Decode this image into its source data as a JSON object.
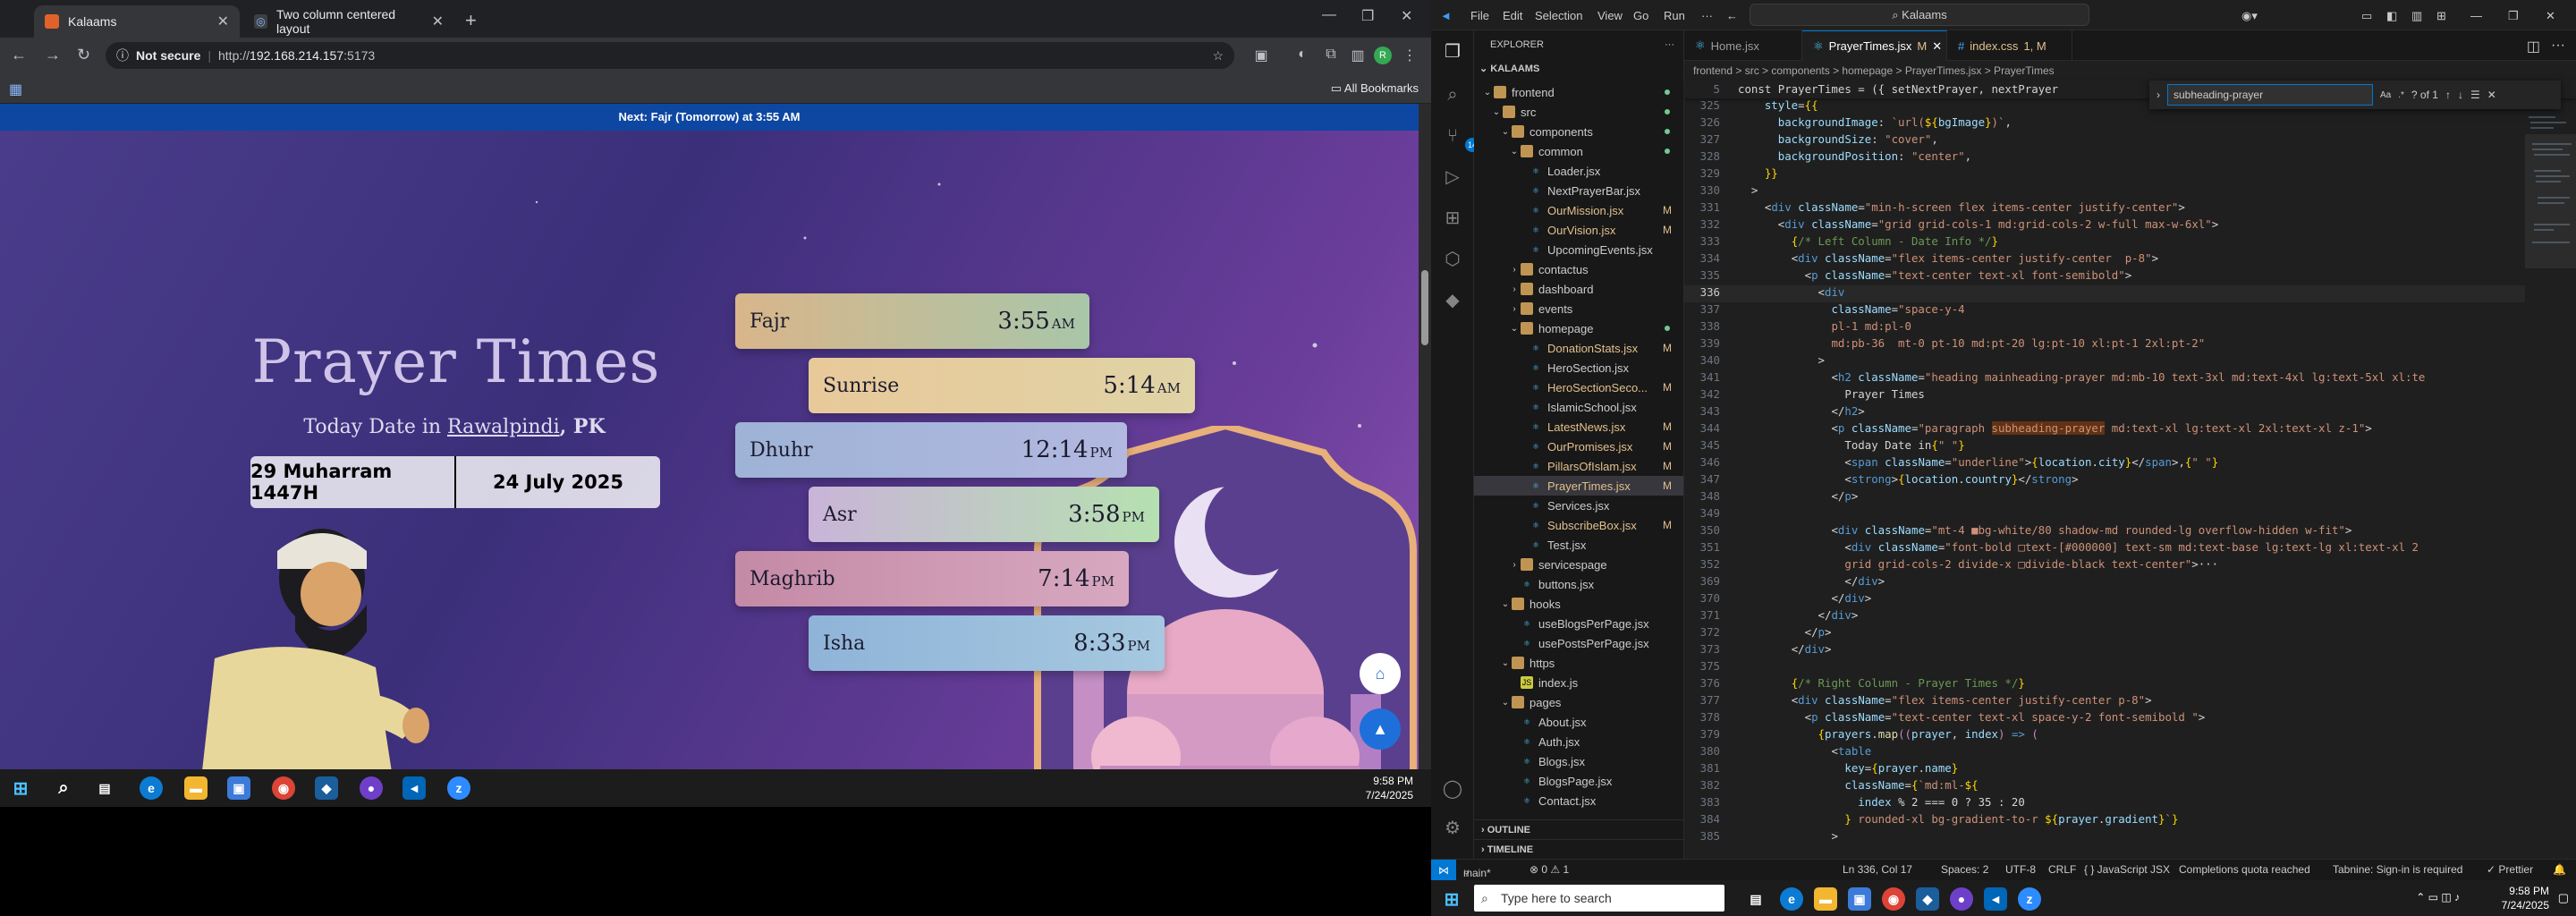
{
  "browser": {
    "tabs": [
      {
        "title": "Kalaams",
        "active": true
      },
      {
        "title": "Two column centered layout",
        "active": false
      }
    ],
    "not_secure": "Not secure",
    "url_prefix": "http://",
    "url_host": "192.168.214.157",
    "url_suffix": ":5173",
    "all_bookmarks": "All Bookmarks",
    "profile_initial": "R"
  },
  "page": {
    "next_prayer_prefix": "Next: ",
    "next_prayer_name": "Fajr (Tomorrow)",
    "next_prayer_suffix": " at 3:55 AM",
    "title": "Prayer Times",
    "date_prefix": "Today Date in ",
    "city": "Rawalpindi",
    "country": ", PK",
    "hijri_date": "29 Muharram 1447H",
    "gregorian_date": "24 July 2025",
    "prayers": [
      {
        "name": "Fajr",
        "time": "3:55",
        "ampm": "AM",
        "gradient": [
          "#d9b58a",
          "#a8c6a8"
        ]
      },
      {
        "name": "Sunrise",
        "time": "5:14",
        "ampm": "AM",
        "gradient": [
          "#e8c99a",
          "#e0d3a6"
        ]
      },
      {
        "name": "Dhuhr",
        "time": "12:14",
        "ampm": "PM",
        "gradient": [
          "#9eb3d6",
          "#b2b8e0"
        ]
      },
      {
        "name": "Asr",
        "time": "3:58",
        "ampm": "PM",
        "gradient": [
          "#c9b4d8",
          "#b6e0b0"
        ]
      },
      {
        "name": "Maghrib",
        "time": "7:14",
        "ampm": "PM",
        "gradient": [
          "#c48aa6",
          "#d7a8c0"
        ]
      },
      {
        "name": "Isha",
        "time": "8:33",
        "ampm": "PM",
        "gradient": [
          "#8fb4d8",
          "#a6c8e0"
        ]
      }
    ]
  },
  "taskbar_left": {
    "time": "9:58 PM",
    "date": "7/24/2025"
  },
  "vscode": {
    "menu": [
      "File",
      "Edit",
      "Selection",
      "View",
      "Go",
      "Run",
      "···"
    ],
    "command_center": "Kalaams",
    "explorer_title": "EXPLORER",
    "workspace": "KALAAMS",
    "tree": [
      {
        "label": "frontend",
        "type": "folder",
        "depth": 0,
        "open": true,
        "dot": true
      },
      {
        "label": "src",
        "type": "folder",
        "depth": 1,
        "open": true,
        "dot": true
      },
      {
        "label": "components",
        "type": "folder",
        "depth": 2,
        "open": true,
        "dot": true
      },
      {
        "label": "common",
        "type": "folder",
        "depth": 3,
        "open": true,
        "dot": true
      },
      {
        "label": "Loader.jsx",
        "type": "jsx",
        "depth": 4
      },
      {
        "label": "NextPrayerBar.jsx",
        "type": "jsx",
        "depth": 4
      },
      {
        "label": "OurMission.jsx",
        "type": "jsx",
        "depth": 4,
        "badge": "M"
      },
      {
        "label": "OurVision.jsx",
        "type": "jsx",
        "depth": 4,
        "badge": "M"
      },
      {
        "label": "UpcomingEvents.jsx",
        "type": "jsx",
        "depth": 4
      },
      {
        "label": "contactus",
        "type": "folder",
        "depth": 3
      },
      {
        "label": "dashboard",
        "type": "folder",
        "depth": 3
      },
      {
        "label": "events",
        "type": "folder",
        "depth": 3
      },
      {
        "label": "homepage",
        "type": "folder",
        "depth": 3,
        "open": true,
        "dot": true
      },
      {
        "label": "DonationStats.jsx",
        "type": "jsx",
        "depth": 4,
        "badge": "M"
      },
      {
        "label": "HeroSection.jsx",
        "type": "jsx",
        "depth": 4
      },
      {
        "label": "HeroSectionSeco...",
        "type": "jsx",
        "depth": 4,
        "badge": "M"
      },
      {
        "label": "IslamicSchool.jsx",
        "type": "jsx",
        "depth": 4
      },
      {
        "label": "LatestNews.jsx",
        "type": "jsx",
        "depth": 4,
        "badge": "M"
      },
      {
        "label": "OurPromises.jsx",
        "type": "jsx",
        "depth": 4,
        "badge": "M"
      },
      {
        "label": "PillarsOfIslam.jsx",
        "type": "jsx",
        "depth": 4,
        "badge": "M"
      },
      {
        "label": "PrayerTimes.jsx",
        "type": "jsx",
        "depth": 4,
        "badge": "M",
        "selected": true
      },
      {
        "label": "Services.jsx",
        "type": "jsx",
        "depth": 4
      },
      {
        "label": "SubscribeBox.jsx",
        "type": "jsx",
        "depth": 4,
        "badge": "M"
      },
      {
        "label": "Test.jsx",
        "type": "jsx",
        "depth": 4
      },
      {
        "label": "servicespage",
        "type": "folder",
        "depth": 3
      },
      {
        "label": "buttons.jsx",
        "type": "jsx",
        "depth": 3
      },
      {
        "label": "hooks",
        "type": "folder",
        "depth": 2,
        "open": true
      },
      {
        "label": "useBlogsPerPage.jsx",
        "type": "jsx",
        "depth": 3
      },
      {
        "label": "usePostsPerPage.jsx",
        "type": "jsx",
        "depth": 3
      },
      {
        "label": "https",
        "type": "folder",
        "depth": 2,
        "open": true
      },
      {
        "label": "index.js",
        "type": "js",
        "depth": 3
      },
      {
        "label": "pages",
        "type": "folder",
        "depth": 2,
        "open": true
      },
      {
        "label": "About.jsx",
        "type": "jsx",
        "depth": 3
      },
      {
        "label": "Auth.jsx",
        "type": "jsx",
        "depth": 3
      },
      {
        "label": "Blogs.jsx",
        "type": "jsx",
        "depth": 3
      },
      {
        "label": "BlogsPage.jsx",
        "type": "jsx",
        "depth": 3
      },
      {
        "label": "Contact.jsx",
        "type": "jsx",
        "depth": 3
      }
    ],
    "outline": "OUTLINE",
    "timeline": "TIMELINE",
    "tabs": [
      {
        "title": "Home.jsx",
        "mod": "",
        "active": false
      },
      {
        "title": "PrayerTimes.jsx",
        "mod": "M",
        "active": true
      },
      {
        "title": "index.css",
        "mod": "1, M",
        "active": false
      }
    ],
    "breadcrumbs": "frontend > src > components > homepage > PrayerTimes.jsx > PrayerTimes",
    "sticky_line": {
      "num": "5",
      "text": "const PrayerTimes = ({ setNextPrayer, nextPrayer"
    },
    "find": {
      "query": "subheading-prayer",
      "result": "? of 1"
    },
    "status": {
      "branch": "main*",
      "problems": "⊗ 0 ⚠ 1",
      "position": "Ln 336, Col 17",
      "spaces": "Spaces: 2",
      "encoding": "UTF-8",
      "eol": "CRLF",
      "language": "{ } JavaScript JSX",
      "quota": "Completions quota reached",
      "tabnine": "Tabnine: Sign-in is required",
      "prettier": "✓ Prettier"
    },
    "code_lines": [
      {
        "n": "325",
        "h": "    <span class='a'>style</span><span class='o'>=</span><span class='p'>{{</span>"
      },
      {
        "n": "326",
        "h": "      <span class='a'>backgroundImage</span><span class='o'>: </span><span class='s'>`url(</span><span class='p'>${</span><span class='a'>bgImage</span><span class='p'>}</span><span class='s'>)`</span><span class='o'>,</span>"
      },
      {
        "n": "327",
        "h": "      <span class='a'>backgroundSize</span><span class='o'>: </span><span class='s'>\"cover\"</span><span class='o'>,</span>"
      },
      {
        "n": "328",
        "h": "      <span class='a'>backgroundPosition</span><span class='o'>: </span><span class='s'>\"center\"</span><span class='o'>,</span>"
      },
      {
        "n": "329",
        "h": "    <span class='p'>}}</span>"
      },
      {
        "n": "330",
        "h": "  <span class='o'>&gt;</span>"
      },
      {
        "n": "331",
        "h": "    <span class='o'>&lt;</span><span class='k'>div</span> <span class='a'>className</span><span class='o'>=</span><span class='s'>\"min-h-screen flex items-center justify-center\"</span><span class='o'>&gt;</span>"
      },
      {
        "n": "332",
        "h": "      <span class='o'>&lt;</span><span class='k'>div</span> <span class='a'>className</span><span class='o'>=</span><span class='s'>\"grid grid-cols-1 md:grid-cols-2 w-full max-w-6xl\"</span><span class='o'>&gt;</span>"
      },
      {
        "n": "333",
        "h": "        <span class='p'>{</span><span class='c'>/* Left Column - Date Info */</span><span class='p'>}</span>"
      },
      {
        "n": "334",
        "h": "        <span class='o'>&lt;</span><span class='k'>div</span> <span class='a'>className</span><span class='o'>=</span><span class='s'>\"flex items-center justify-center  p-8\"</span><span class='o'>&gt;</span>"
      },
      {
        "n": "335",
        "h": "          <span class='o'>&lt;</span><span class='k'>p</span> <span class='a'>className</span><span class='o'>=</span><span class='s'>\"text-center text-xl font-semibold\"</span><span class='o'>&gt;</span>"
      },
      {
        "n": "336",
        "h": "            <span class='o'>&lt;</span><span class='k'>div</span>",
        "cur": true
      },
      {
        "n": "337",
        "h": "              <span class='a'>className</span><span class='o'>=</span><span class='s'>\"space-y-4</span>"
      },
      {
        "n": "338",
        "h": "              <span class='s'>pl-1 md:pl-0</span>"
      },
      {
        "n": "339",
        "h": "              <span class='s'>md:pb-36  mt-0 pt-10 md:pt-20 lg:pt-10 xl:pt-1 2xl:pt-2\"</span>"
      },
      {
        "n": "340",
        "h": "            <span class='o'>&gt;</span>"
      },
      {
        "n": "341",
        "h": "              <span class='o'>&lt;</span><span class='k'>h2</span> <span class='a'>className</span><span class='o'>=</span><span class='s'>\"heading mainheading-prayer md:mb-10 text-3xl md:text-4xl lg:text-5xl xl:te</span>"
      },
      {
        "n": "342",
        "h": "                <span class='o'>Prayer Times</span>"
      },
      {
        "n": "343",
        "h": "              <span class='o'>&lt;/</span><span class='k'>h2</span><span class='o'>&gt;</span>"
      },
      {
        "n": "344",
        "h": "              <span class='o'>&lt;</span><span class='k'>p</span> <span class='a'>className</span><span class='o'>=</span><span class='s'>\"paragraph <span class='hl'>subheading-prayer</span> md:text-xl lg:text-xl 2xl:text-xl z-1\"</span><span class='o'>&gt;</span>"
      },
      {
        "n": "345",
        "h": "                <span class='o'>Today Date in</span><span class='p'>{</span><span class='s'>\" \"</span><span class='p'>}</span>"
      },
      {
        "n": "346",
        "h": "                <span class='o'>&lt;</span><span class='k'>span</span> <span class='a'>className</span><span class='o'>=</span><span class='s'>\"underline\"</span><span class='o'>&gt;</span><span class='p'>{</span><span class='a'>location</span><span class='o'>.</span><span class='a'>city</span><span class='p'>}</span><span class='o'>&lt;/</span><span class='k'>span</span><span class='o'>&gt;,</span><span class='p'>{</span><span class='s'>\" \"</span><span class='p'>}</span>"
      },
      {
        "n": "347",
        "h": "                <span class='o'>&lt;</span><span class='k'>strong</span><span class='o'>&gt;</span><span class='p'>{</span><span class='a'>location</span><span class='o'>.</span><span class='a'>country</span><span class='p'>}</span><span class='o'>&lt;/</span><span class='k'>strong</span><span class='o'>&gt;</span>"
      },
      {
        "n": "348",
        "h": "              <span class='o'>&lt;/</span><span class='k'>p</span><span class='o'>&gt;</span>"
      },
      {
        "n": "349",
        "h": ""
      },
      {
        "n": "350",
        "h": "              <span class='o'>&lt;</span><span class='k'>div</span> <span class='a'>className</span><span class='o'>=</span><span class='s'>\"mt-4 ■bg-white/80 shadow-md rounded-lg overflow-hidden w-fit\"</span><span class='o'>&gt;</span>"
      },
      {
        "n": "351",
        "h": "                <span class='o'>&lt;</span><span class='k'>div</span> <span class='a'>className</span><span class='o'>=</span><span class='s'>\"font-bold □text-[#000000] text-sm md:text-base lg:text-lg xl:text-xl 2</span>"
      },
      {
        "n": "352",
        "h": "                <span class='s'>grid grid-cols-2 divide-x □divide-black text-center\"</span><span class='o'>&gt;···</span>"
      },
      {
        "n": "369",
        "h": "                <span class='o'>&lt;/</span><span class='k'>div</span><span class='o'>&gt;</span>"
      },
      {
        "n": "370",
        "h": "              <span class='o'>&lt;/</span><span class='k'>div</span><span class='o'>&gt;</span>"
      },
      {
        "n": "371",
        "h": "            <span class='o'>&lt;/</span><span class='k'>div</span><span class='o'>&gt;</span>"
      },
      {
        "n": "372",
        "h": "          <span class='o'>&lt;/</span><span class='k'>p</span><span class='o'>&gt;</span>"
      },
      {
        "n": "373",
        "h": "        <span class='o'>&lt;/</span><span class='k'>div</span><span class='o'>&gt;</span>"
      },
      {
        "n": "375",
        "h": ""
      },
      {
        "n": "376",
        "h": "        <span class='p'>{</span><span class='c'>/* Right Column - Prayer Times */</span><span class='p'>}</span>"
      },
      {
        "n": "377",
        "h": "        <span class='o'>&lt;</span><span class='k'>div</span> <span class='a'>className</span><span class='o'>=</span><span class='s'>\"flex items-center justify-center p-8\"</span><span class='o'>&gt;</span>"
      },
      {
        "n": "378",
        "h": "          <span class='o'>&lt;</span><span class='k'>p</span> <span class='a'>className</span><span class='o'>=</span><span class='s'>\"text-center text-xl space-y-2 font-semibold \"</span><span class='o'>&gt;</span>"
      },
      {
        "n": "379",
        "h": "            <span class='p'>{</span><span class='a'>prayers</span><span class='o'>.</span><span class='f'>map</span><span class='v'>((</span><span class='a'>prayer</span><span class='o'>, </span><span class='a'>index</span><span class='v'>)</span> <span class='k'>=&gt;</span> <span class='v'>(</span>"
      },
      {
        "n": "380",
        "h": "              <span class='o'>&lt;</span><span class='k'>table</span>"
      },
      {
        "n": "381",
        "h": "                <span class='a'>key</span><span class='o'>=</span><span class='p'>{</span><span class='a'>prayer</span><span class='o'>.</span><span class='a'>name</span><span class='p'>}</span>"
      },
      {
        "n": "382",
        "h": "                <span class='a'>className</span><span class='o'>=</span><span class='p'>{</span><span class='s'>`md:ml-</span><span class='p'>${</span>"
      },
      {
        "n": "383",
        "h": "                  <span class='a'>index</span> <span class='o'>% 2 === 0 ? 35 : 20</span>"
      },
      {
        "n": "384",
        "h": "                <span class='p'>}</span><span class='s'> rounded-xl bg-gradient-to-r </span><span class='p'>${</span><span class='a'>prayer</span><span class='o'>.</span><span class='a'>gradient</span><span class='p'>}</span><span class='s'>`</span><span class='p'>}</span>"
      },
      {
        "n": "385",
        "h": "              <span class='o'>&gt;</span>"
      }
    ]
  },
  "taskbar_right": {
    "search_placeholder": "Type here to search",
    "time": "9:58 PM",
    "date": "7/24/2025"
  }
}
